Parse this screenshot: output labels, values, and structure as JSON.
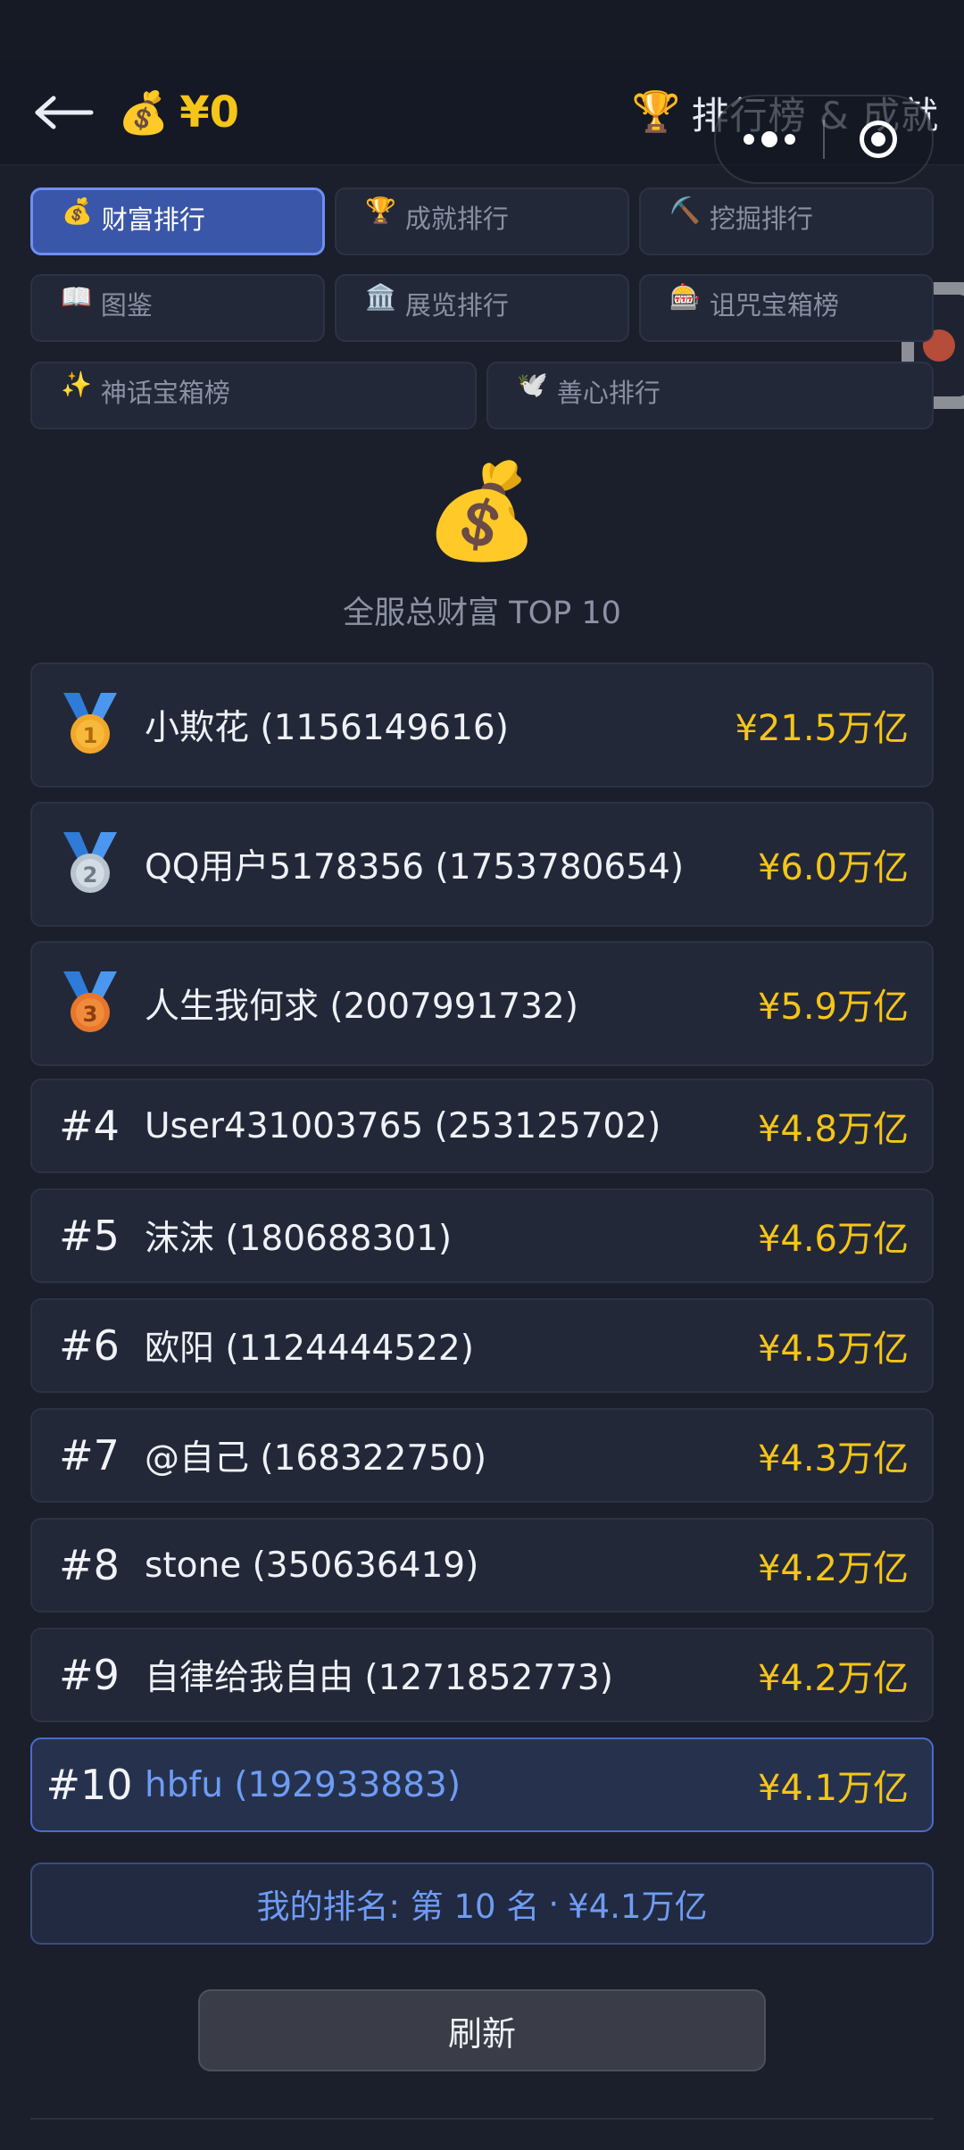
{
  "header": {
    "balance": "¥0",
    "balance_icon": "money-bag",
    "title": "排行榜 & 成就",
    "title_icon": "trophy"
  },
  "tabs": [
    {
      "icon": "💰",
      "label": "财富排行",
      "active": true
    },
    {
      "icon": "🏆",
      "label": "成就排行",
      "active": false
    },
    {
      "icon": "⛏️",
      "label": "挖掘排行",
      "active": false
    },
    {
      "icon": "📖",
      "label": "图鉴",
      "active": false
    },
    {
      "icon": "🏛️",
      "label": "展览排行",
      "active": false
    },
    {
      "icon": "🎰",
      "label": "诅咒宝箱榜",
      "active": false
    },
    {
      "icon": "✨",
      "label": "神话宝箱榜",
      "active": false
    },
    {
      "icon": "🕊️",
      "label": "善心排行",
      "active": false
    }
  ],
  "hero": {
    "icon": "💰",
    "title": "全服总财富 TOP 10"
  },
  "rankings": [
    {
      "rank": "#1",
      "medal": "gold",
      "medal_number": "1",
      "name": "小欺花 (1156149616)",
      "amount": "¥21.5万亿"
    },
    {
      "rank": "#2",
      "medal": "silver",
      "medal_number": "2",
      "name": "QQ用户5178356 (1753780654)",
      "amount": "¥6.0万亿"
    },
    {
      "rank": "#3",
      "medal": "bronze",
      "medal_number": "3",
      "name": "人生我何求 (2007991732)",
      "amount": "¥5.9万亿"
    },
    {
      "rank": "#4",
      "medal": null,
      "name": "User431003765 (253125702)",
      "amount": "¥4.8万亿"
    },
    {
      "rank": "#5",
      "medal": null,
      "name": "沫沫 (180688301)",
      "amount": "¥4.6万亿"
    },
    {
      "rank": "#6",
      "medal": null,
      "name": "欧阳 (1124444522)",
      "amount": "¥4.5万亿"
    },
    {
      "rank": "#7",
      "medal": null,
      "name": "@自己 (168322750)",
      "amount": "¥4.3万亿"
    },
    {
      "rank": "#8",
      "medal": null,
      "name": "stone (350636419)",
      "amount": "¥4.2万亿"
    },
    {
      "rank": "#9",
      "medal": null,
      "name": "自律给我自由 (1271852773)",
      "amount": "¥4.2万亿"
    },
    {
      "rank": "#10",
      "medal": null,
      "name": "hbfu (192933883)",
      "amount": "¥4.1万亿",
      "is_me": true
    }
  ],
  "my_rank": {
    "label": "我的排名: 第 10 名",
    "separator": "·",
    "amount": "¥4.1万亿"
  },
  "refresh_label": "刷新",
  "colors": {
    "background": "#1b1f2b",
    "accent_gold": "#f5c518",
    "active_tab": "#3a56a8",
    "me_blue": "#6e9cf5"
  }
}
